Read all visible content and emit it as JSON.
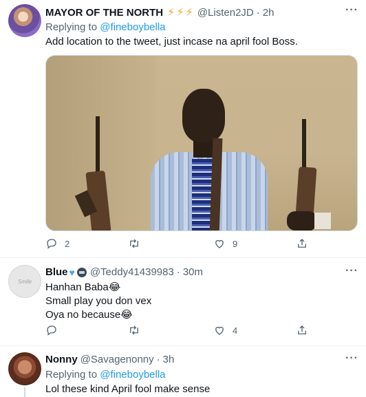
{
  "tweets": [
    {
      "name": "MAYOR OF THE NORTH",
      "name_decoration": "⚡⚡⚡",
      "handle": "@Listen2JD",
      "time": "2h",
      "replying_prefix": "Replying to",
      "replying_to": "@fineboybella",
      "lines": [
        "Add location to the tweet, just incase na april fool Boss."
      ],
      "reply_count": "2",
      "retweet_count": "",
      "like_count": "9"
    },
    {
      "name": "Blue",
      "handle": "@Teddy41439983",
      "time": "30m",
      "avatar_text": "Smile",
      "lines": [
        "Hanhan Baba😂",
        "Small play you don vex",
        "Oya no because😂"
      ],
      "reply_count": "",
      "retweet_count": "",
      "like_count": "4"
    },
    {
      "name": "Nonny",
      "handle": "@Savagenonny",
      "time": "3h",
      "replying_prefix": "Replying to",
      "replying_to": "@fineboybella",
      "lines": [
        "Lol these kind April fool make sense"
      ]
    }
  ],
  "separator": "·",
  "more_icon": "···",
  "icons": {
    "reply": "reply-icon",
    "retweet": "retweet-icon",
    "like": "heart-icon",
    "share": "share-icon"
  },
  "colors": {
    "link": "#1d9bf0",
    "secondary_text": "#536471",
    "divider": "#eff3f4"
  }
}
